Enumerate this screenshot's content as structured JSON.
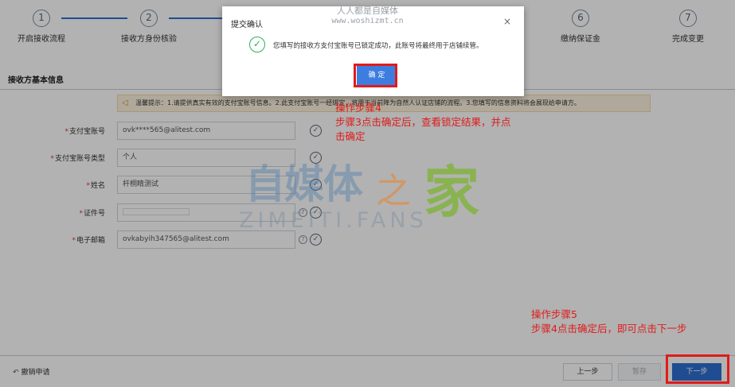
{
  "stepper": {
    "steps": [
      {
        "num": "1",
        "label": "开启接收流程"
      },
      {
        "num": "2",
        "label": "接收方身份核验"
      },
      {
        "num": "6",
        "label": "缴纳保证金"
      },
      {
        "num": "7",
        "label": "完成变更"
      }
    ]
  },
  "section": {
    "title": "接收方基本信息"
  },
  "notice": {
    "text": "温馨提示：1.请提供真实有效的支付宝账号信息。2.此支付宝账号一经绑定，将用于当前降为自然人认证店铺的流程。3.您填写的信息资料将会展现给申请方。"
  },
  "form": {
    "rows": [
      {
        "label": "支付宝账号",
        "value": "ovk****565@alitest.com"
      },
      {
        "label": "支付宝账号类型",
        "value": "个人"
      },
      {
        "label": "姓名",
        "value": "杆桐睛测试"
      },
      {
        "label": "证件号",
        "value": ""
      },
      {
        "label": "电子邮箱",
        "value": "ovkabyih347565@alitest.com"
      }
    ]
  },
  "footer": {
    "cancel_label": "撤销申请",
    "prev_label": "上一步",
    "save_label": "暂存",
    "next_label": "下一步"
  },
  "modal": {
    "title": "提交确认",
    "message": "您填写的接收方支付宝账号已锁定成功，此账号将最终用于店铺续管。",
    "confirm_label": "确 定",
    "close_symbol": "×"
  },
  "watermark": {
    "line1": "人人都是自媒体",
    "line2": "www.woshizmt.cn",
    "logo_cn": "自媒体",
    "logo_zhi": "之",
    "logo_jia": "家",
    "logo_en": "ZIMEITI.FANS"
  },
  "annotations": {
    "step4_title": "操作步骤4",
    "step4_text": "步骤3点击确定后，查看锁定结果，并点击确定",
    "step5_title": "操作步骤5",
    "step5_text": "步骤4点击确定后，即可点击下一步"
  },
  "colors": {
    "primary": "#2f6fd0",
    "annotation_red": "#e01b1b",
    "success_green": "#2fae5c"
  },
  "icons": [
    "speaker-icon",
    "check-circle-icon",
    "help-icon",
    "close-icon",
    "back-arrow-icon",
    "success-icon"
  ]
}
